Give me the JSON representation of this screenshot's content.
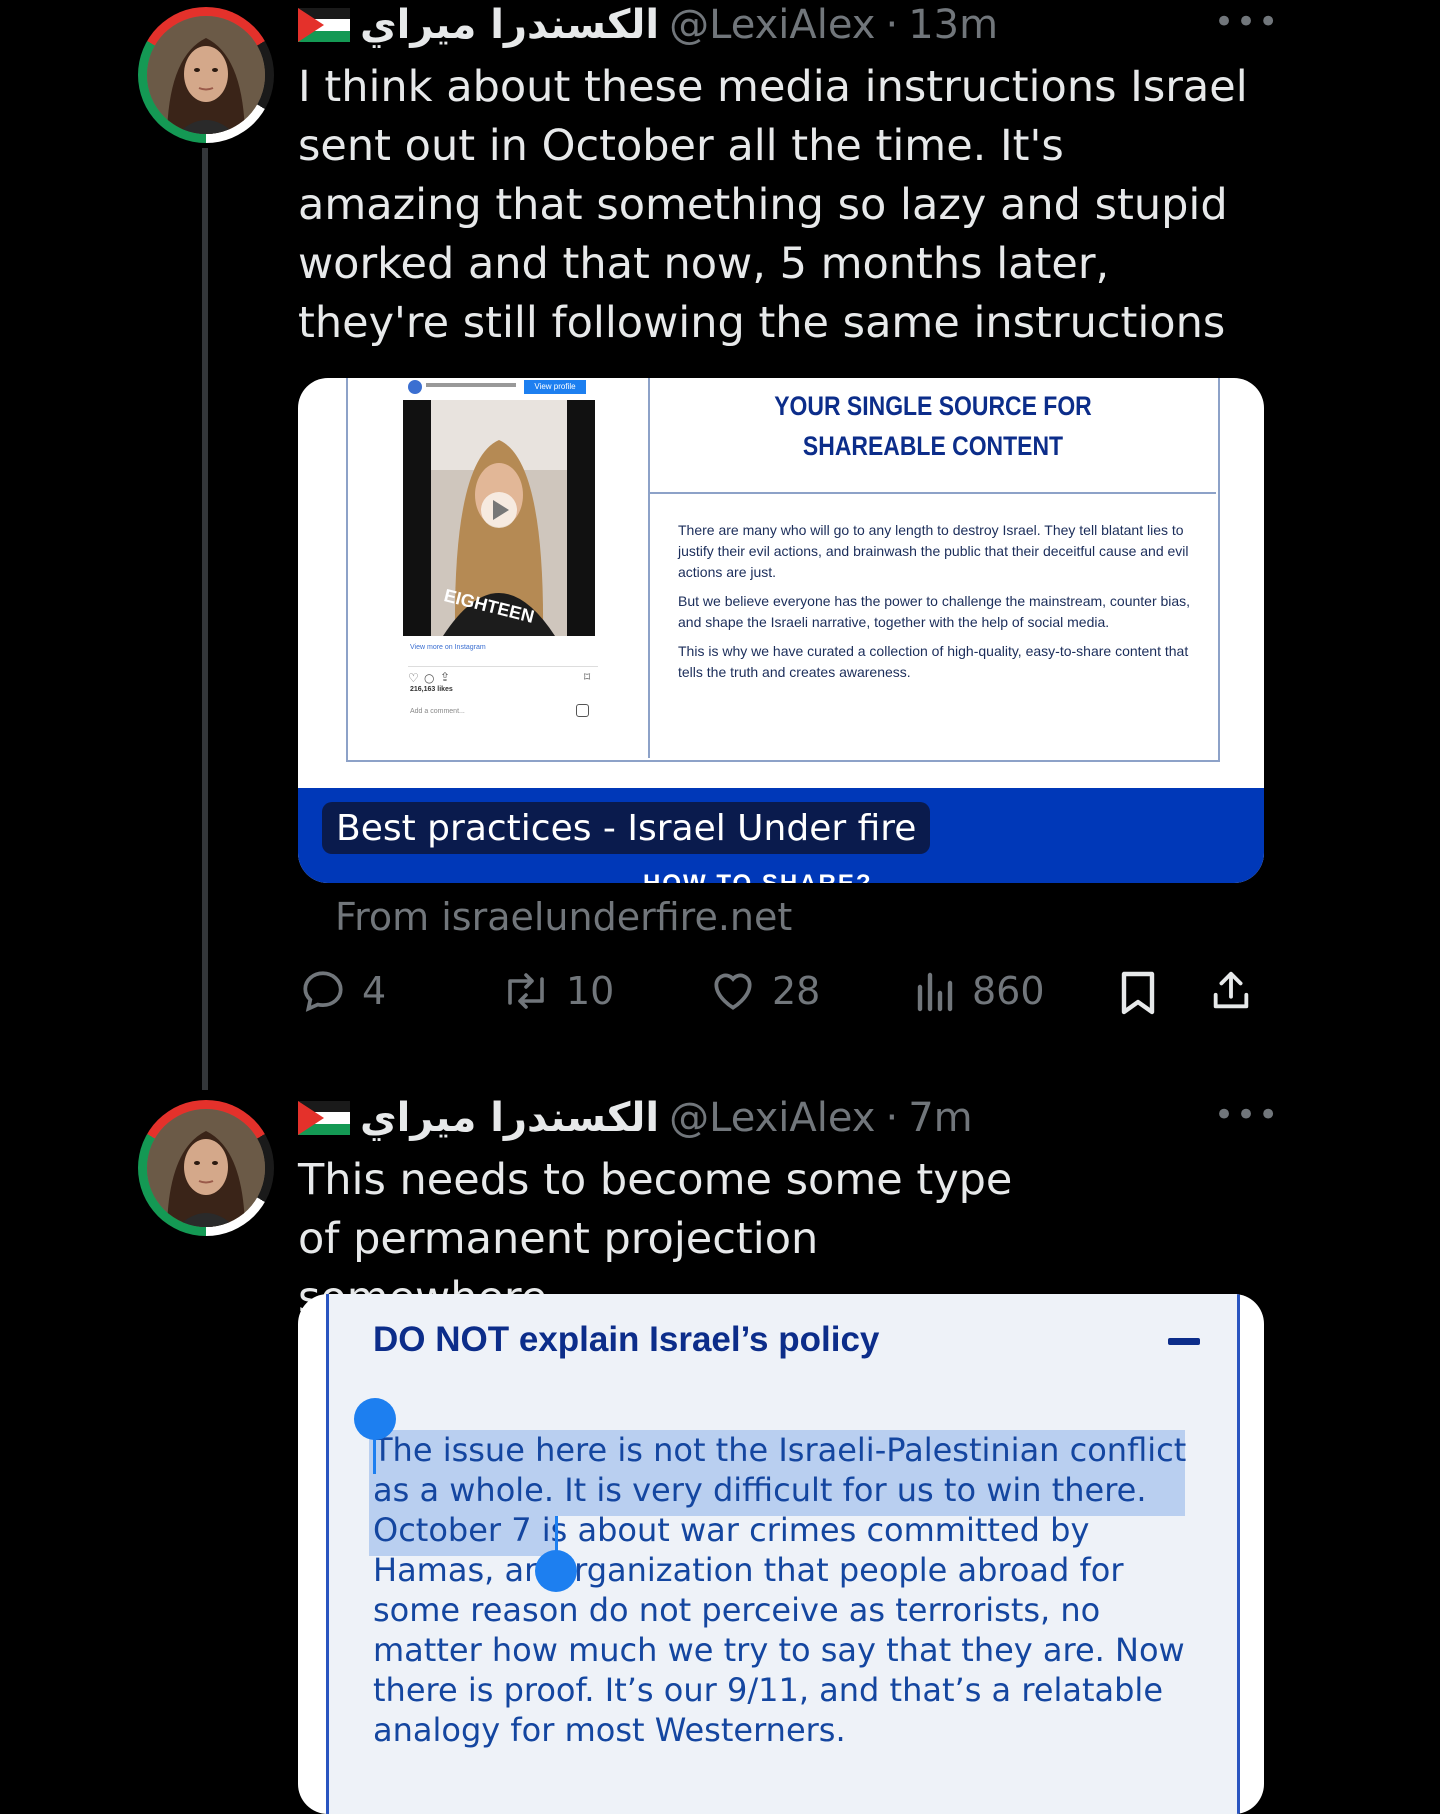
{
  "tweets": [
    {
      "display_name": "الكسندرا ميراي",
      "handle": "@LexiAlex",
      "separator": "·",
      "time": "13m",
      "more_icon": "•••",
      "text": "I think about these media instructions Israel sent out in October all the time. It's amazing that something so lazy and stupid worked and that now, 5 months later, they're still following the same instructions",
      "card": {
        "headline": "YOUR SINGLE SOURCE FOR SHAREABLE CONTENT",
        "paragraphs": [
          "There are many who will go to any length to destroy Israel. They tell blatant lies to justify their evil actions, and brainwash the public that their deceitful cause and evil actions are just.",
          "But we believe everyone has the power to challenge the mainstream, counter bias, and shape the Israeli narrative, together with the help of social media.",
          "This is why we have curated a collection of high-quality, easy-to-share content that tells the truth and creates awareness."
        ],
        "insta_view_profile": "View profile",
        "insta_shirt_text": "EIGHTEEN",
        "insta_view_more": "View more on Instagram",
        "insta_likes": "216,163 likes",
        "insta_add_comment": "Add a comment...",
        "title": "Best practices - Israel Under fire",
        "cut_off_text": "HOW TO SHARE?",
        "from": "From israelunderfire.net"
      },
      "actions": {
        "replies": "4",
        "retweets": "10",
        "likes": "28",
        "views": "860"
      }
    },
    {
      "display_name": "الكسندرا ميراي",
      "handle": "@LexiAlex",
      "separator": "·",
      "time": "7m",
      "more_icon": "•••",
      "text": "This needs to become some type of permanent projection somewhere",
      "card": {
        "heading": "DO NOT explain Israel’s policy",
        "collapse_icon": "−",
        "paragraph_selected": "The issue here is not the Israeli-Palestinian conflict as a whole. It is very difficult for us to win there.",
        "paragraph_rest": " October 7 is about war crimes committed by Hamas, an organization that people abroad for some reason do not perceive as terrorists, no matter how much we try to say that they are. Now there is proof. It’s our 9/11, and that’s a relatable analogy for most Westerners."
      }
    }
  ],
  "colors": {
    "background": "#000000",
    "text": "#e7e9ea",
    "muted": "#71767b",
    "card_blue": "#0038b8",
    "card_title_bg": "#0a1b4d",
    "doc_text": "#1446a0",
    "doc_heading": "#0c2d8a",
    "selection": "#b9cff0",
    "handle_blue": "#1d7ff0"
  }
}
